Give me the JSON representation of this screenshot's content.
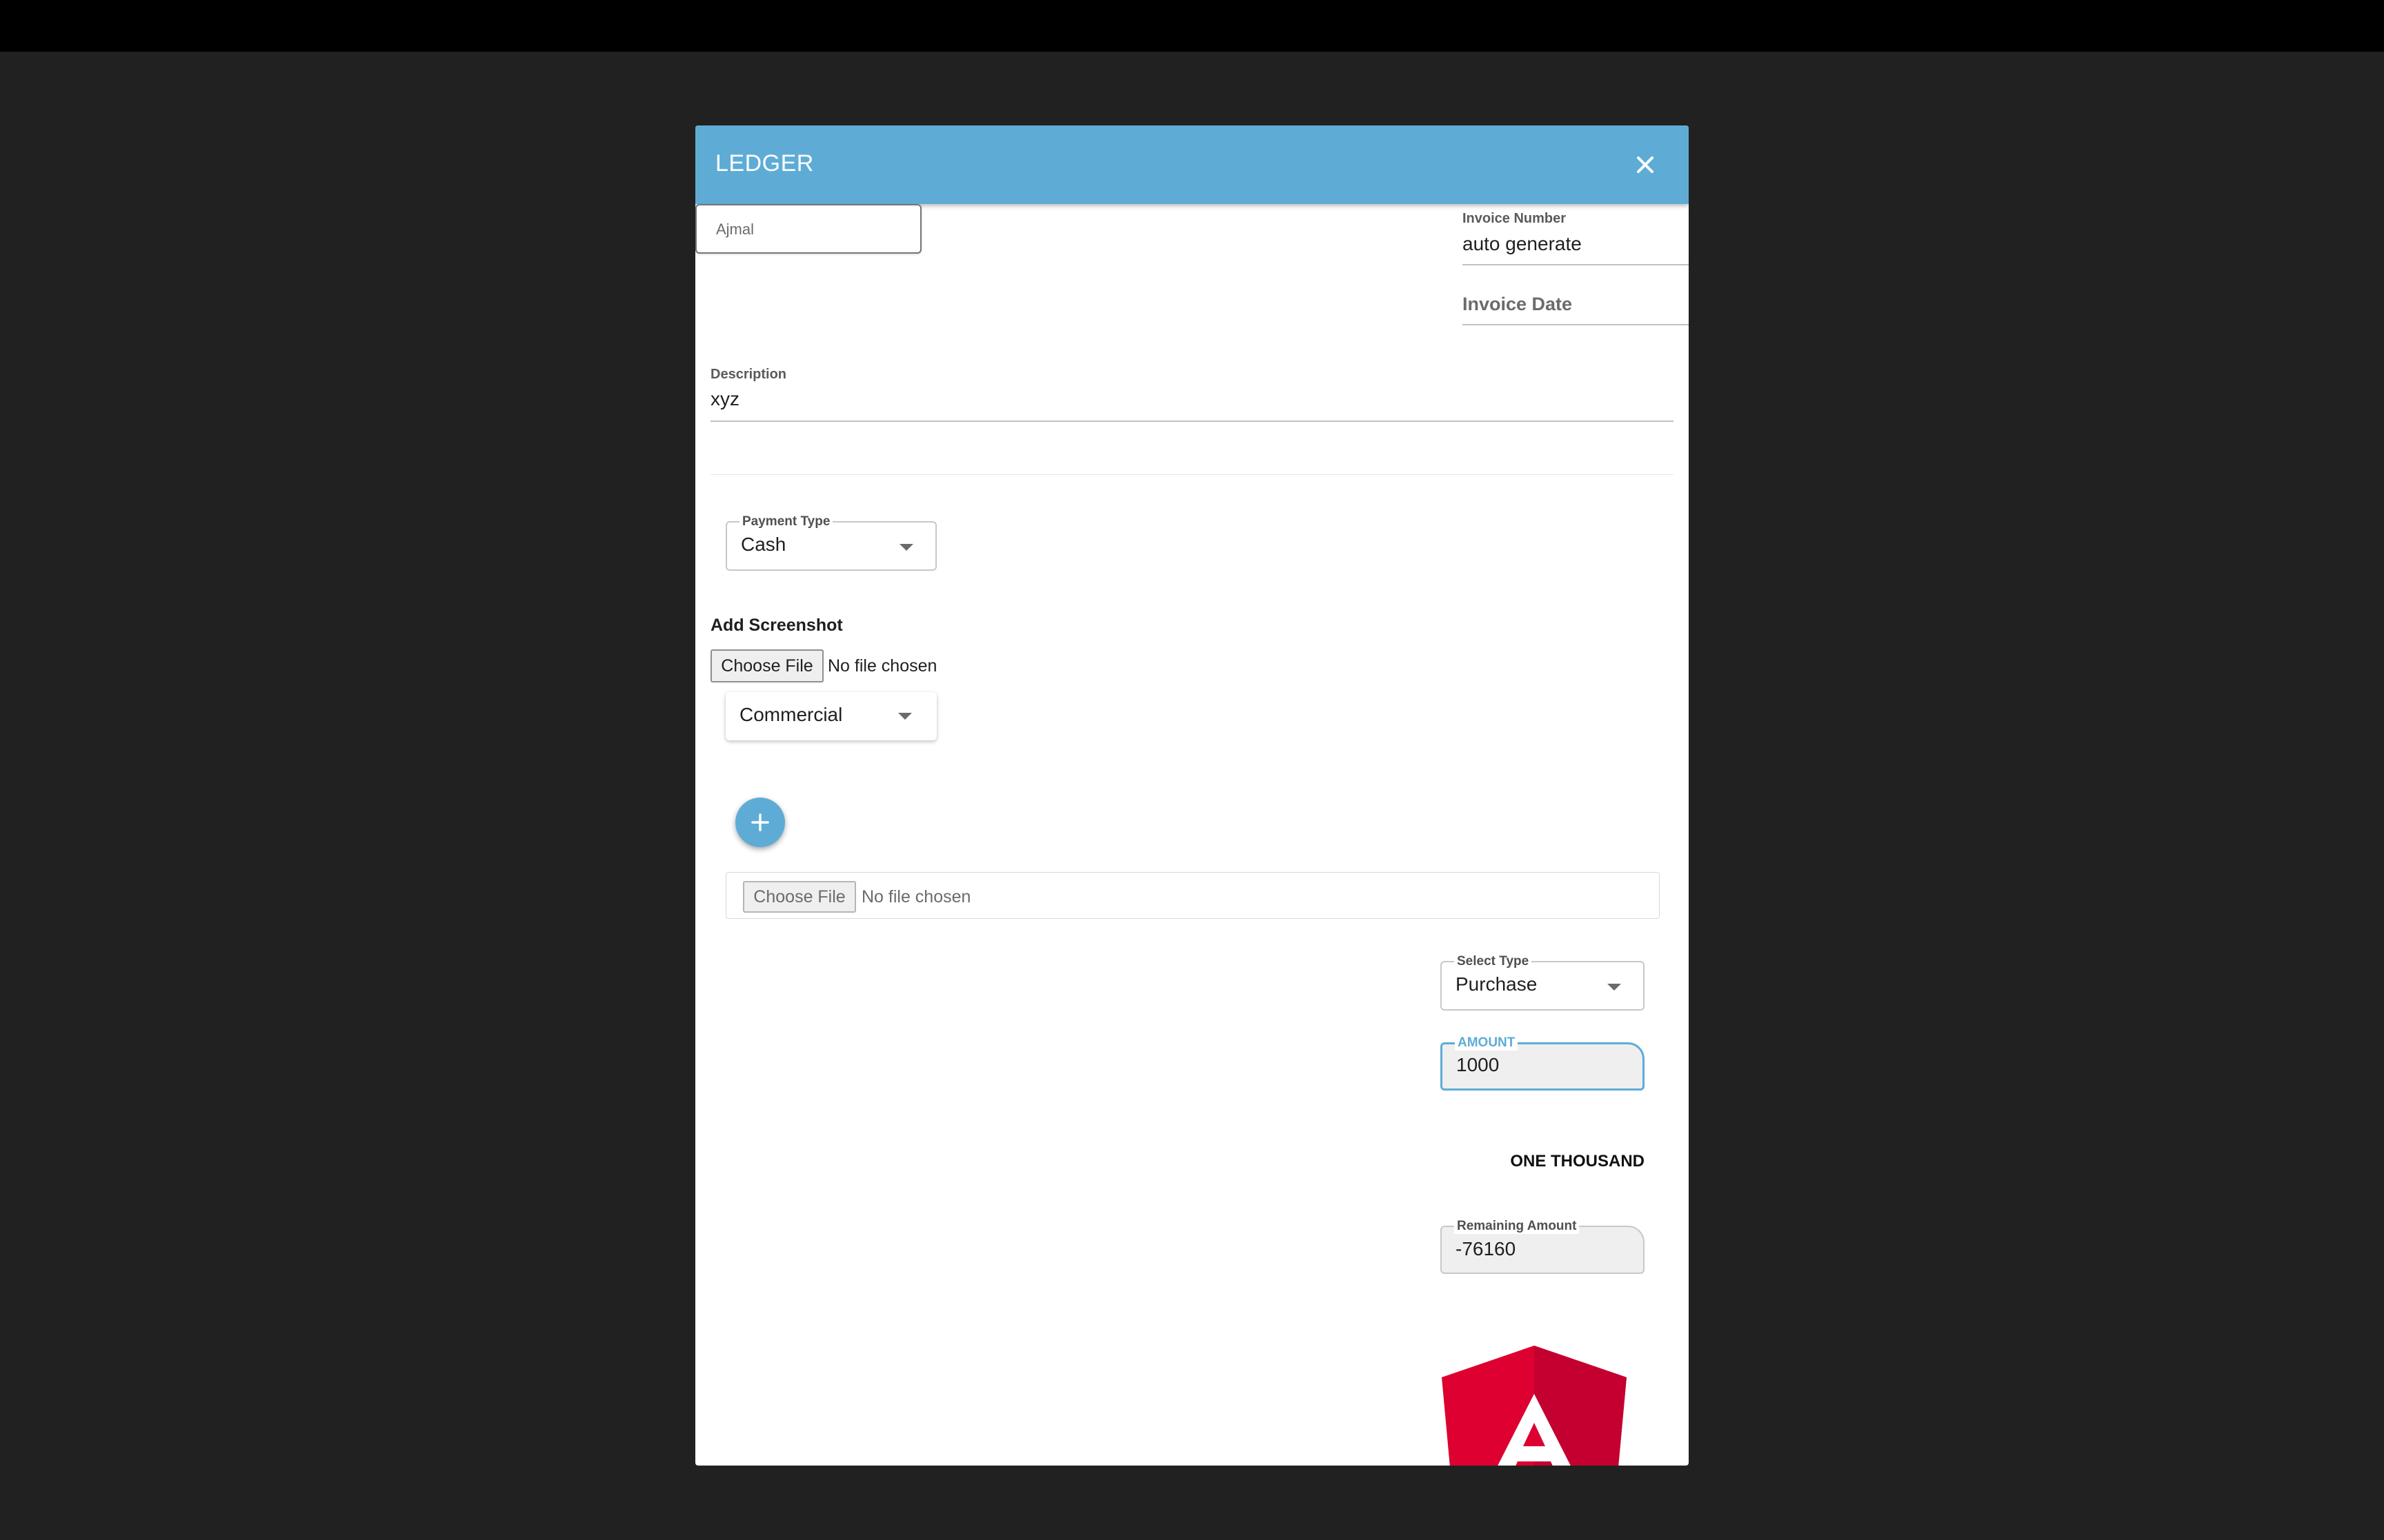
{
  "window": {
    "title": "LEDGER"
  },
  "customer": {
    "value": "Ajmal"
  },
  "invoice": {
    "number_label": "Invoice Number",
    "number_value": "auto generate",
    "date_label": "Invoice Date"
  },
  "description": {
    "label": "Description",
    "value": "xyz"
  },
  "payment_type": {
    "label": "Payment Type",
    "value": "Cash"
  },
  "screenshot": {
    "heading": "Add Screenshot",
    "choose_label": "Choose File",
    "status": "No file chosen"
  },
  "category": {
    "value": "Commercial"
  },
  "attachment": {
    "choose_label": "Choose File",
    "status": "No file chosen"
  },
  "select_type": {
    "label": "Select Type",
    "value": "Purchase"
  },
  "amount": {
    "label": "AMOUNT",
    "value": "1000",
    "words": "ONE THOUSAND"
  },
  "remaining": {
    "label": "Remaining Amount",
    "value": "-76160"
  },
  "icons": {
    "close": "close-icon",
    "add": "plus-icon",
    "logo": "angular-logo",
    "dropdown": "caret-down-icon"
  },
  "colors": {
    "header": "#5eacd6",
    "focus": "#5eacd6",
    "backdrop": "#212121",
    "logo_red": "#dd0031"
  }
}
